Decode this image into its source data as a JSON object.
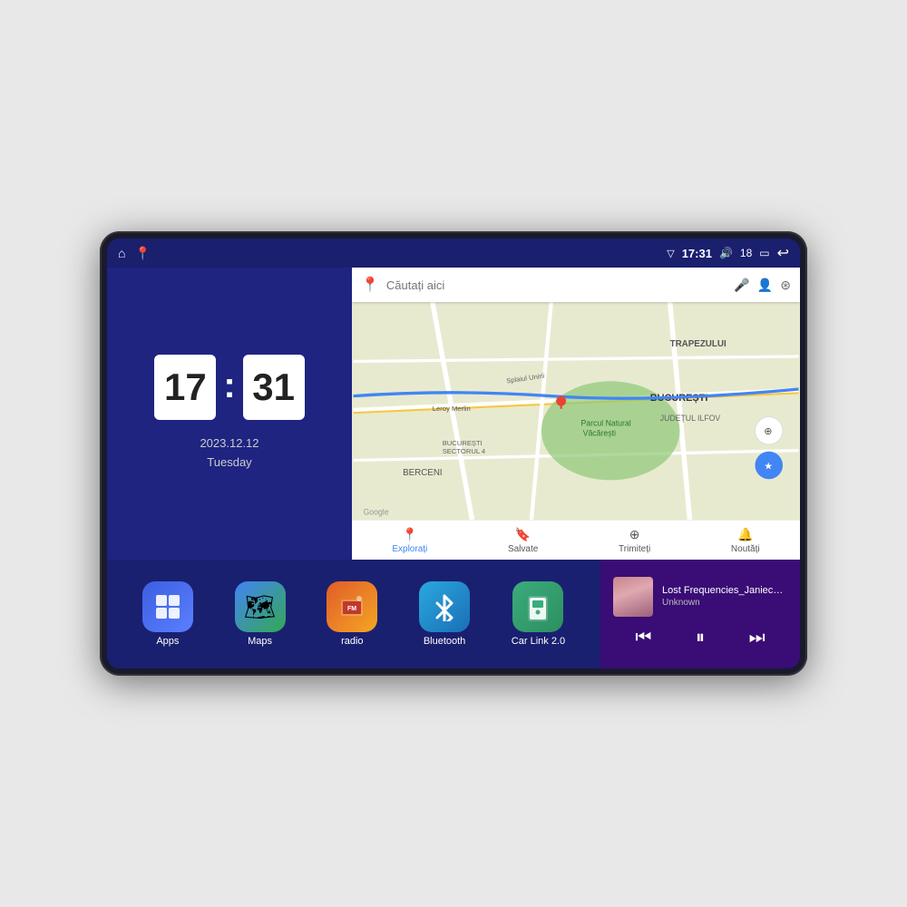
{
  "device": {
    "screen_bg": "#1a1f6e"
  },
  "status_bar": {
    "time": "17:31",
    "signal": "18",
    "signal_icon": "▽",
    "volume_icon": "🔊",
    "battery_icon": "🔋",
    "back_icon": "↩",
    "home_icon": "⌂",
    "maps_icon": "📍"
  },
  "clock": {
    "hour": "17",
    "minute": "31",
    "date": "2023.12.12",
    "day": "Tuesday"
  },
  "map": {
    "search_placeholder": "Căutați aici",
    "nav_items": [
      {
        "label": "Explorați",
        "icon": "📍",
        "active": true
      },
      {
        "label": "Salvate",
        "icon": "🔖",
        "active": false
      },
      {
        "label": "Trimiteți",
        "icon": "⊕",
        "active": false
      },
      {
        "label": "Noutăți",
        "icon": "🔔",
        "active": false
      }
    ],
    "locations": [
      "TRAPEZULUI",
      "BUCUREȘTI",
      "JUDEȚUL ILFOV",
      "BERCENI",
      "Parcul Natural Văcărești",
      "Leroy Merlin",
      "BUCUREȘTI SECTORUL 4"
    ]
  },
  "apps": [
    {
      "id": "apps",
      "label": "Apps",
      "icon": "⊞",
      "color_class": "icon-apps"
    },
    {
      "id": "maps",
      "label": "Maps",
      "icon": "🗺",
      "color_class": "icon-maps"
    },
    {
      "id": "radio",
      "label": "radio",
      "icon": "📻",
      "color_class": "icon-radio"
    },
    {
      "id": "bluetooth",
      "label": "Bluetooth",
      "icon": "₿",
      "color_class": "icon-bluetooth"
    },
    {
      "id": "carlink",
      "label": "Car Link 2.0",
      "icon": "📱",
      "color_class": "icon-carlink"
    }
  ],
  "music": {
    "title": "Lost Frequencies_Janieck Devy-...",
    "artist": "Unknown",
    "prev_icon": "⏮",
    "play_icon": "⏸",
    "next_icon": "⏭"
  }
}
